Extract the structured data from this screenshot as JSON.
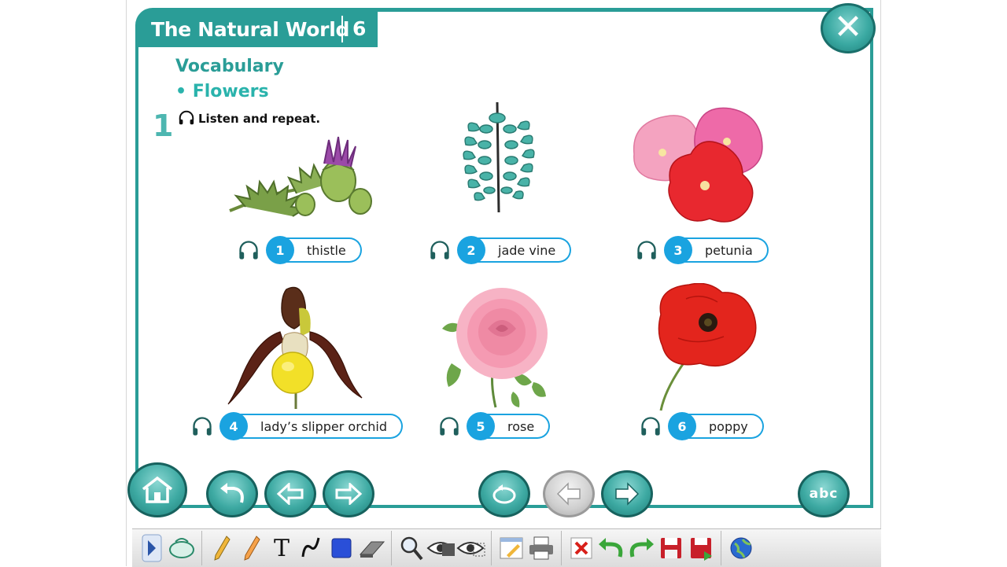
{
  "unit": {
    "title": "The Natural World",
    "number": "6"
  },
  "section": {
    "title": "Vocabulary",
    "subtitle": "•  Flowers"
  },
  "exercise": {
    "number": "1",
    "instruction": "Listen and repeat."
  },
  "items": [
    {
      "number": "1",
      "word": "thistle"
    },
    {
      "number": "2",
      "word": "jade vine"
    },
    {
      "number": "3",
      "word": "petunia"
    },
    {
      "number": "4",
      "word": "lady’s slipper orchid"
    },
    {
      "number": "5",
      "word": "rose"
    },
    {
      "number": "6",
      "word": "poppy"
    }
  ],
  "colors": {
    "teal": "#2a9d97",
    "blue": "#1aa3e0",
    "close": "#3aa9a2"
  },
  "close_icon": "✕",
  "toolbar_text_tool": "T",
  "spell_icon_letters": "abc"
}
